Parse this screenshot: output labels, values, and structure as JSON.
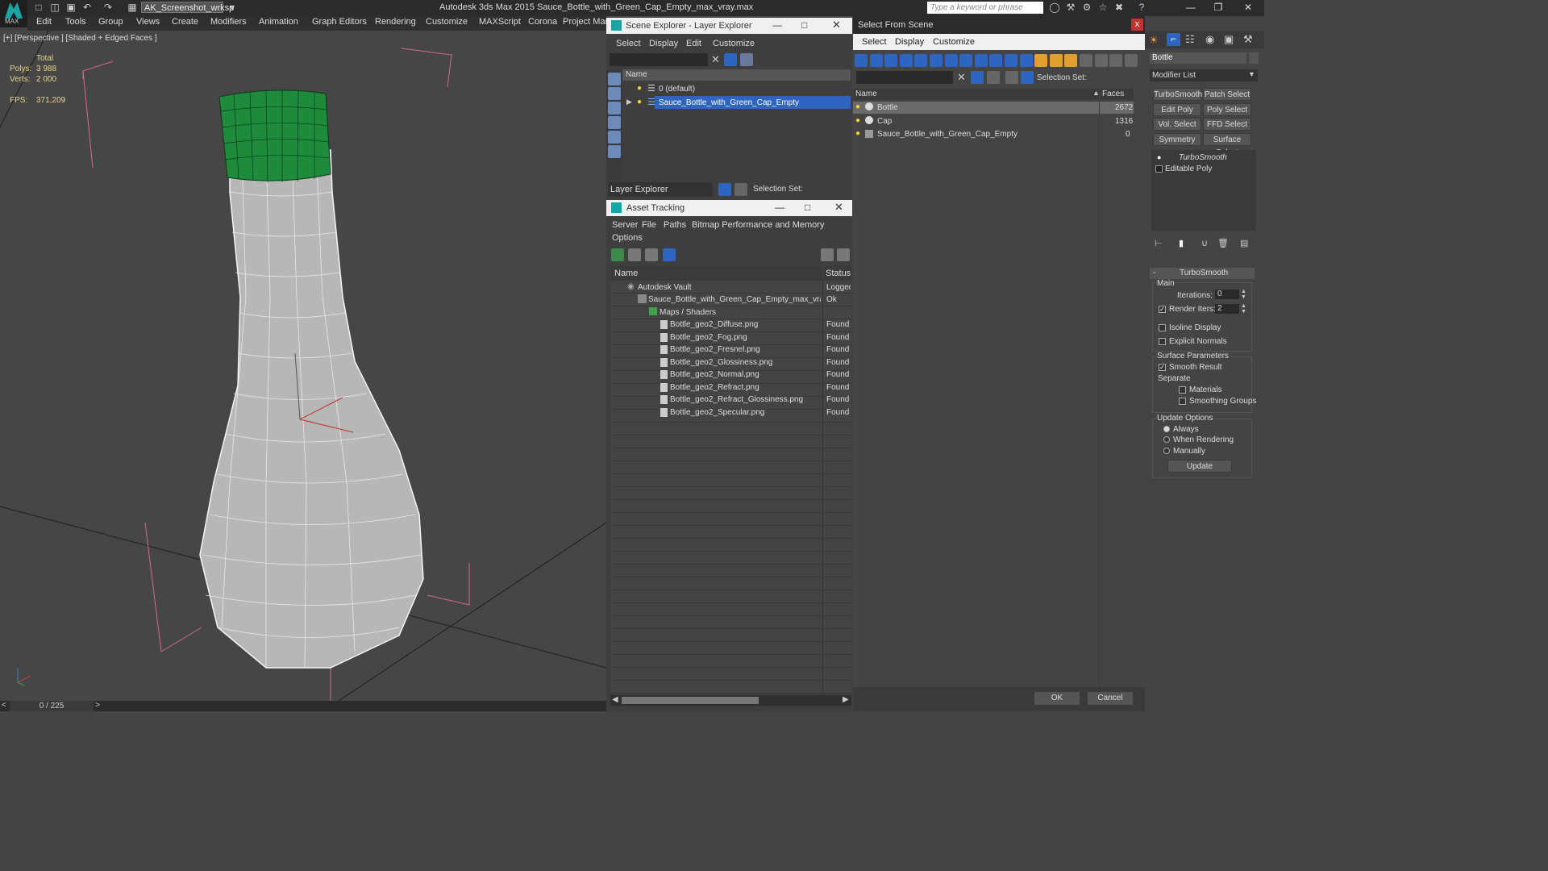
{
  "app": {
    "title": "Autodesk 3ds Max  2015     Sauce_Bottle_with_Green_Cap_Empty_max_vray.max",
    "logo_text": "MAX",
    "workspace": "AK_Screenshot_wrksp",
    "search_placeholder": "Type a keyword or phrase"
  },
  "menubar": [
    "Edit",
    "Tools",
    "Group",
    "Views",
    "Create",
    "Modifiers",
    "Animation",
    "Graph Editors",
    "Rendering",
    "Customize",
    "MAXScript",
    "Corona",
    "Project Man"
  ],
  "viewport": {
    "label": "[+] [Perspective ] [Shaded + Edged Faces ]",
    "stats_header": "Total",
    "polys_label": "Polys:",
    "polys_value": "3 988",
    "verts_label": "Verts:",
    "verts_value": "2 000",
    "fps_label": "FPS:",
    "fps_value": "371,209",
    "frame": "0 / 225",
    "prev": "<",
    "next": ">"
  },
  "scene_explorer": {
    "title": "Scene Explorer - Layer Explorer",
    "menus": [
      "Select",
      "Display",
      "Edit",
      "Customize"
    ],
    "col_name": "Name",
    "rows": [
      "0 (default)",
      "Sauce_Bottle_with_Green_Cap_Empty"
    ],
    "footer_dropdown": "Layer Explorer",
    "selection_set": "Selection Set:"
  },
  "asset_tracking": {
    "title": "Asset Tracking",
    "menus": [
      "Server",
      "File",
      "Paths",
      "Bitmap Performance and Memory"
    ],
    "menu2": "Options",
    "col_name": "Name",
    "col_status": "Status",
    "rows": [
      {
        "name": "Autodesk Vault",
        "status": "Logged"
      },
      {
        "name": "Sauce_Bottle_with_Green_Cap_Empty_max_vray...",
        "status": "Ok"
      },
      {
        "name": "Maps / Shaders",
        "status": ""
      },
      {
        "name": "Bottle_geo2_Diffuse.png",
        "status": "Found"
      },
      {
        "name": "Bottle_geo2_Fog.png",
        "status": "Found"
      },
      {
        "name": "Bottle_geo2_Fresnel.png",
        "status": "Found"
      },
      {
        "name": "Bottle_geo2_Glossiness.png",
        "status": "Found"
      },
      {
        "name": "Bottle_geo2_Normal.png",
        "status": "Found"
      },
      {
        "name": "Bottle_geo2_Refract.png",
        "status": "Found"
      },
      {
        "name": "Bottle_geo2_Refract_Glossiness.png",
        "status": "Found"
      },
      {
        "name": "Bottle_geo2_Specular.png",
        "status": "Found"
      }
    ]
  },
  "select_from_scene": {
    "title": "Select From Scene",
    "close": "x",
    "menus": [
      "Select",
      "Display",
      "Customize"
    ],
    "selection_set": "Selection Set:",
    "col_name": "Name",
    "col_faces": "Faces",
    "rows": [
      {
        "name": "Bottle",
        "faces": "2672"
      },
      {
        "name": "Cap",
        "faces": "1316"
      },
      {
        "name": "Sauce_Bottle_with_Green_Cap_Empty",
        "faces": "0"
      }
    ],
    "ok": "OK",
    "cancel": "Cancel"
  },
  "command_panel": {
    "object_name": "Bottle",
    "modifier_list": "Modifier List",
    "buttons": [
      "TurboSmooth",
      "Patch Select",
      "Edit Poly",
      "Poly Select",
      "Vol. Select",
      "FFD Select",
      "Symmetry",
      "Surface Select"
    ],
    "stack": [
      "TurboSmooth",
      "Editable Poly"
    ],
    "rollout_title": "TurboSmooth",
    "rollout_toggle": "-",
    "main_label": "Main",
    "iterations_label": "Iterations:",
    "iterations_value": "0",
    "render_iters_label": "Render Iters:",
    "render_iters_value": "2",
    "isoline": "Isoline Display",
    "explicit_normals": "Explicit Normals",
    "surface_params": "Surface Parameters",
    "smooth_result": "Smooth Result",
    "separate": "Separate",
    "materials": "Materials",
    "smoothing_groups": "Smoothing Groups",
    "update_options": "Update Options",
    "always": "Always",
    "when_rendering": "When Rendering",
    "manually": "Manually",
    "update": "Update"
  },
  "colors": {
    "selection": "#2d65c0",
    "cap_green": "#1e8a3c",
    "stats_yellow": "#e8d38a",
    "teal_logo": "#1aa5a5"
  }
}
